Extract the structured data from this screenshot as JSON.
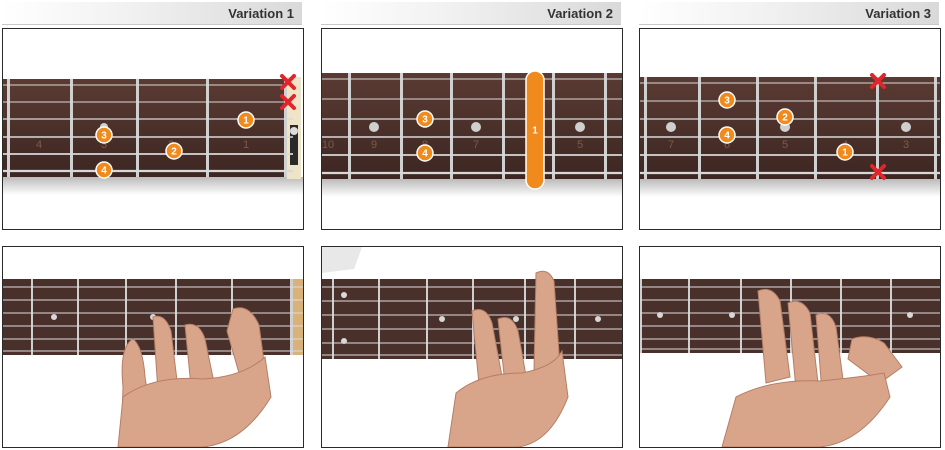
{
  "variations": [
    {
      "title": "Variation 1",
      "fret_numbers": [
        "4",
        "3",
        "2",
        "1"
      ],
      "fingers": [
        "1",
        "2",
        "3",
        "4"
      ],
      "muted_strings": 2
    },
    {
      "title": "Variation 2",
      "fret_numbers": [
        "10",
        "9",
        "8",
        "7",
        "6",
        "5"
      ],
      "fingers": [
        "1",
        "3",
        "4"
      ],
      "barre_finger": "1"
    },
    {
      "title": "Variation 3",
      "fret_numbers": [
        "7",
        "6",
        "5",
        "4",
        "3"
      ],
      "fingers": [
        "1",
        "2",
        "3",
        "4"
      ],
      "muted_strings": 2
    }
  ],
  "colors": {
    "finger_marker": "#f08a1c",
    "mute_marker": "#e0262a",
    "fretboard": "#4a302a",
    "skin": "#d9a58a"
  }
}
